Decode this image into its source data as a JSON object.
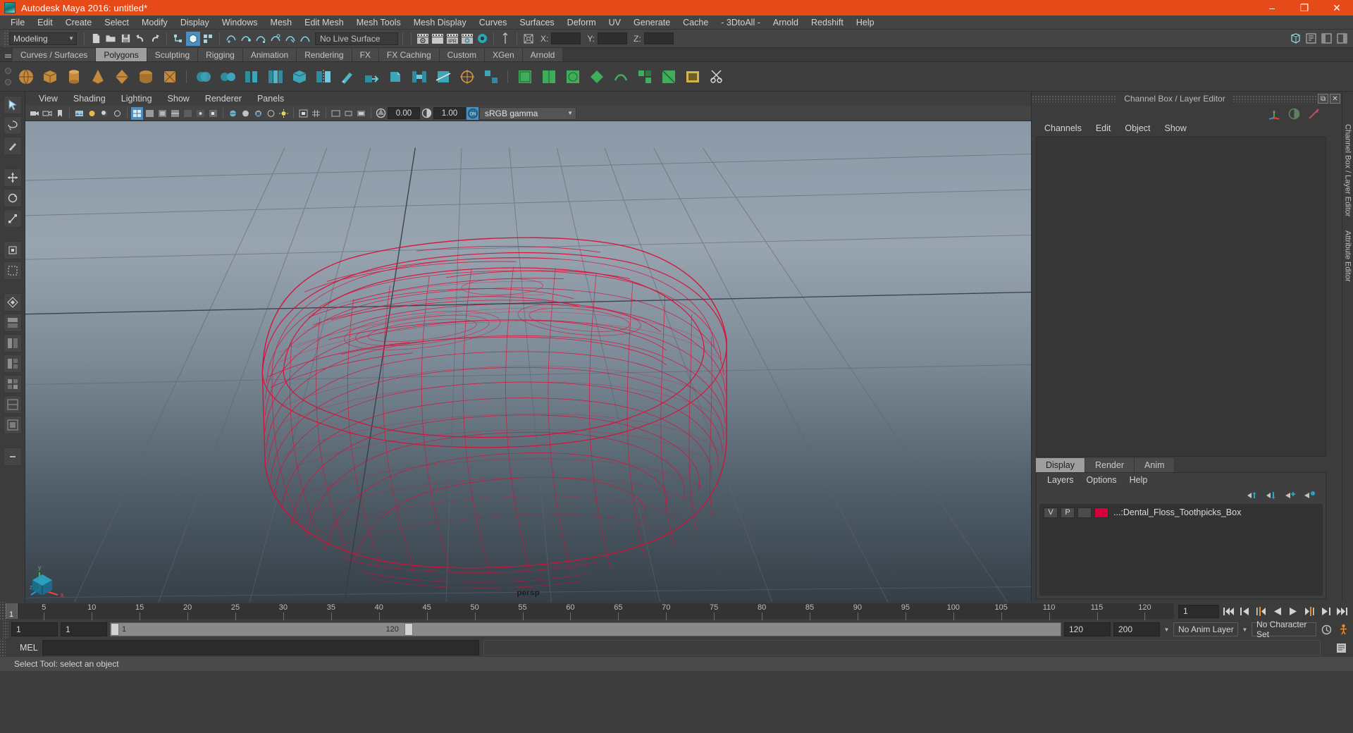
{
  "window": {
    "title": "Autodesk Maya 2016: untitled*",
    "app_icon": "maya-logo-icon",
    "controls": {
      "minimize": "–",
      "maximize": "❐",
      "close": "✕"
    },
    "titlebar_color": "#e64a19"
  },
  "menubar": {
    "items": [
      "File",
      "Edit",
      "Create",
      "Select",
      "Modify",
      "Display",
      "Windows",
      "Mesh",
      "Edit Mesh",
      "Mesh Tools",
      "Mesh Display",
      "Curves",
      "Surfaces",
      "Deform",
      "UV",
      "Generate",
      "Cache",
      "- 3DtoAll -",
      "Arnold",
      "Redshift",
      "Help"
    ]
  },
  "statusline": {
    "menu_set": "Modeling",
    "live_surface": "No Live Surface",
    "coords": {
      "x_label": "X:",
      "x_value": "",
      "y_label": "Y:",
      "y_value": "",
      "z_label": "Z:",
      "z_value": ""
    }
  },
  "shelf": {
    "tabs": [
      "Curves / Surfaces",
      "Polygons",
      "Sculpting",
      "Rigging",
      "Animation",
      "Rendering",
      "FX",
      "FX Caching",
      "Custom",
      "XGen",
      "Arnold"
    ],
    "active_tab": "Polygons"
  },
  "viewport": {
    "menu": [
      "View",
      "Shading",
      "Lighting",
      "Show",
      "Renderer",
      "Panels"
    ],
    "exposure": "0.00",
    "gamma": "1.00",
    "color_management": "sRGB gamma",
    "camera_label": "persp",
    "axis": {
      "x": "x",
      "y": "y",
      "z": "z"
    },
    "object_color": "#d80f38"
  },
  "channel_box": {
    "panel_title": "Channel Box / Layer Editor",
    "menu": [
      "Channels",
      "Edit",
      "Object",
      "Show"
    ],
    "side_tabs": [
      "Channel Box / Layer Editor",
      "Attribute Editor"
    ]
  },
  "layer_editor": {
    "tabs": [
      "Display",
      "Render",
      "Anim"
    ],
    "active_tab": "Display",
    "menu": [
      "Layers",
      "Options",
      "Help"
    ],
    "layers": [
      {
        "visibility": "V",
        "playback": "P",
        "shading": "",
        "color": "#d8003c",
        "name": "...:Dental_Floss_Toothpicks_Box"
      }
    ]
  },
  "timeline": {
    "current_frame": "1",
    "current_frame_field": "1",
    "ticks": [
      5,
      10,
      15,
      20,
      25,
      30,
      35,
      40,
      45,
      50,
      55,
      60,
      65,
      70,
      75,
      80,
      85,
      90,
      95,
      100,
      105,
      110,
      115,
      120
    ],
    "start": 1,
    "end": 120
  },
  "range_slider": {
    "anim_start": "1",
    "range_start": "1",
    "bar_start_label": "1",
    "bar_end_label": "120",
    "range_end": "120",
    "anim_end": "200",
    "anim_layer": "No Anim Layer",
    "character_set": "No Character Set"
  },
  "command_line": {
    "label": "MEL",
    "input_value": "",
    "output_value": ""
  },
  "status_bar": {
    "message": "Select Tool: select an object"
  }
}
